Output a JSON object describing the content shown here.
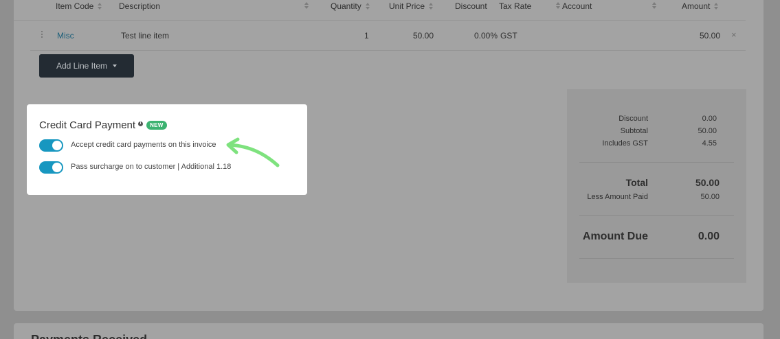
{
  "table": {
    "headers": {
      "item_code": "Item Code",
      "description": "Description",
      "quantity": "Quantity",
      "unit_price": "Unit Price",
      "discount": "Discount",
      "tax_rate": "Tax Rate",
      "account": "Account",
      "amount": "Amount"
    },
    "row": {
      "item_code": "Misc",
      "description": "Test line item",
      "quantity": "1",
      "unit_price": "50.00",
      "discount": "0.00%",
      "tax_rate": "GST",
      "account": "",
      "amount": "50.00",
      "remove": "×"
    },
    "add_button": "Add Line Item"
  },
  "totals": {
    "discount_label": "Discount",
    "discount_value": "0.00",
    "subtotal_label": "Subtotal",
    "subtotal_value": "50.00",
    "gst_label": "Includes GST",
    "gst_value": "4.55",
    "total_label": "Total",
    "total_value": "50.00",
    "paid_label": "Less Amount Paid",
    "paid_value": "50.00",
    "due_label": "Amount Due",
    "due_value": "0.00"
  },
  "payment_popup": {
    "title": "Credit Card Payment",
    "info": "i",
    "badge": "NEW",
    "toggles": [
      {
        "label": "Accept credit card payments on this invoice",
        "on": true
      },
      {
        "label": "Pass surcharge on to customer | Additional 1.18",
        "on": true
      }
    ]
  },
  "section2": {
    "title": "Payments Received"
  },
  "colors": {
    "toggle_on": "#1797c0",
    "badge": "#3cb371",
    "arrow": "#7ee27e",
    "button_bg": "#232b33"
  }
}
